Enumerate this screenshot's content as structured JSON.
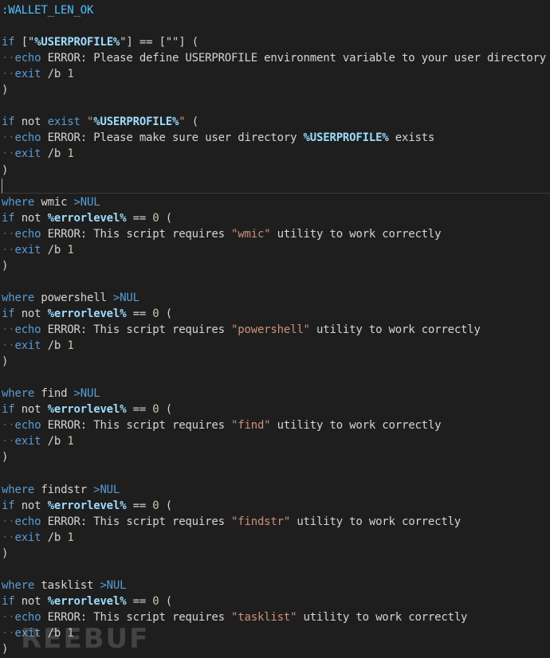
{
  "editor": {
    "lines": [
      [
        {
          "t": ":WALLET_LEN_OK",
          "c": "label"
        }
      ],
      [],
      [
        {
          "t": "if",
          "c": "kw"
        },
        {
          "t": " ",
          "c": "ws"
        },
        {
          "t": "[\"",
          "c": "txt"
        },
        {
          "t": "%USERPROFILE%",
          "c": "var"
        },
        {
          "t": "\"]",
          "c": "txt"
        },
        {
          "t": " ",
          "c": "ws"
        },
        {
          "t": "==",
          "c": "txt"
        },
        {
          "t": " ",
          "c": "ws"
        },
        {
          "t": "[\"\"]",
          "c": "txt"
        },
        {
          "t": " ",
          "c": "ws"
        },
        {
          "t": "(",
          "c": "txt"
        }
      ],
      [
        {
          "t": "··",
          "c": "ws"
        },
        {
          "t": "echo",
          "c": "kw"
        },
        {
          "t": " ERROR: Please define USERPROFILE environment variable to your user directory",
          "c": "txt"
        }
      ],
      [
        {
          "t": "··",
          "c": "ws"
        },
        {
          "t": "exit",
          "c": "kw"
        },
        {
          "t": " /b ",
          "c": "txt"
        },
        {
          "t": "1",
          "c": "num"
        }
      ],
      [
        {
          "t": ")",
          "c": "txt"
        }
      ],
      [],
      [
        {
          "t": "if",
          "c": "kw"
        },
        {
          "t": " not ",
          "c": "txt"
        },
        {
          "t": "exist",
          "c": "kw"
        },
        {
          "t": " ",
          "c": "ws"
        },
        {
          "t": "\"",
          "c": "str"
        },
        {
          "t": "%USERPROFILE%",
          "c": "var"
        },
        {
          "t": "\"",
          "c": "str"
        },
        {
          "t": " (",
          "c": "txt"
        }
      ],
      [
        {
          "t": "··",
          "c": "ws"
        },
        {
          "t": "echo",
          "c": "kw"
        },
        {
          "t": " ERROR: Please make sure user directory ",
          "c": "txt"
        },
        {
          "t": "%USERPROFILE%",
          "c": "var"
        },
        {
          "t": " exists",
          "c": "txt"
        }
      ],
      [
        {
          "t": "··",
          "c": "ws"
        },
        {
          "t": "exit",
          "c": "kw"
        },
        {
          "t": " /b ",
          "c": "txt"
        },
        {
          "t": "1",
          "c": "num"
        }
      ],
      [
        {
          "t": ")",
          "c": "txt"
        }
      ],
      [],
      [
        {
          "t": "where",
          "c": "kw"
        },
        {
          "t": " wmic ",
          "c": "txt"
        },
        {
          "t": ">NUL",
          "c": "kw"
        }
      ],
      [
        {
          "t": "if",
          "c": "kw"
        },
        {
          "t": " not ",
          "c": "txt"
        },
        {
          "t": "%errorlevel%",
          "c": "var"
        },
        {
          "t": " == ",
          "c": "txt"
        },
        {
          "t": "0",
          "c": "num"
        },
        {
          "t": " (",
          "c": "txt"
        }
      ],
      [
        {
          "t": "··",
          "c": "ws"
        },
        {
          "t": "echo",
          "c": "kw"
        },
        {
          "t": " ERROR: This script requires ",
          "c": "txt"
        },
        {
          "t": "\"wmic\"",
          "c": "str"
        },
        {
          "t": " utility to work correctly",
          "c": "txt"
        }
      ],
      [
        {
          "t": "··",
          "c": "ws"
        },
        {
          "t": "exit",
          "c": "kw"
        },
        {
          "t": " /b ",
          "c": "txt"
        },
        {
          "t": "1",
          "c": "num"
        }
      ],
      [
        {
          "t": ")",
          "c": "txt"
        }
      ],
      [],
      [
        {
          "t": "where",
          "c": "kw"
        },
        {
          "t": " powershell ",
          "c": "txt"
        },
        {
          "t": ">NUL",
          "c": "kw"
        }
      ],
      [
        {
          "t": "if",
          "c": "kw"
        },
        {
          "t": " not ",
          "c": "txt"
        },
        {
          "t": "%errorlevel%",
          "c": "var"
        },
        {
          "t": " == ",
          "c": "txt"
        },
        {
          "t": "0",
          "c": "num"
        },
        {
          "t": " (",
          "c": "txt"
        }
      ],
      [
        {
          "t": "··",
          "c": "ws"
        },
        {
          "t": "echo",
          "c": "kw"
        },
        {
          "t": " ERROR: This script requires ",
          "c": "txt"
        },
        {
          "t": "\"powershell\"",
          "c": "str"
        },
        {
          "t": " utility to work correctly",
          "c": "txt"
        }
      ],
      [
        {
          "t": "··",
          "c": "ws"
        },
        {
          "t": "exit",
          "c": "kw"
        },
        {
          "t": " /b ",
          "c": "txt"
        },
        {
          "t": "1",
          "c": "num"
        }
      ],
      [
        {
          "t": ")",
          "c": "txt"
        }
      ],
      [],
      [
        {
          "t": "where",
          "c": "kw"
        },
        {
          "t": " find ",
          "c": "txt"
        },
        {
          "t": ">NUL",
          "c": "kw"
        }
      ],
      [
        {
          "t": "if",
          "c": "kw"
        },
        {
          "t": " not ",
          "c": "txt"
        },
        {
          "t": "%errorlevel%",
          "c": "var"
        },
        {
          "t": " == ",
          "c": "txt"
        },
        {
          "t": "0",
          "c": "num"
        },
        {
          "t": " (",
          "c": "txt"
        }
      ],
      [
        {
          "t": "··",
          "c": "ws"
        },
        {
          "t": "echo",
          "c": "kw"
        },
        {
          "t": " ERROR: This script requires ",
          "c": "txt"
        },
        {
          "t": "\"find\"",
          "c": "str"
        },
        {
          "t": " utility to work correctly",
          "c": "txt"
        }
      ],
      [
        {
          "t": "··",
          "c": "ws"
        },
        {
          "t": "exit",
          "c": "kw"
        },
        {
          "t": " /b ",
          "c": "txt"
        },
        {
          "t": "1",
          "c": "num"
        }
      ],
      [
        {
          "t": ")",
          "c": "txt"
        }
      ],
      [],
      [
        {
          "t": "where",
          "c": "kw"
        },
        {
          "t": " findstr ",
          "c": "txt"
        },
        {
          "t": ">NUL",
          "c": "kw"
        }
      ],
      [
        {
          "t": "if",
          "c": "kw"
        },
        {
          "t": " not ",
          "c": "txt"
        },
        {
          "t": "%errorlevel%",
          "c": "var"
        },
        {
          "t": " == ",
          "c": "txt"
        },
        {
          "t": "0",
          "c": "num"
        },
        {
          "t": " (",
          "c": "txt"
        }
      ],
      [
        {
          "t": "··",
          "c": "ws"
        },
        {
          "t": "echo",
          "c": "kw"
        },
        {
          "t": " ERROR: This script requires ",
          "c": "txt"
        },
        {
          "t": "\"findstr\"",
          "c": "str"
        },
        {
          "t": " utility to work correctly",
          "c": "txt"
        }
      ],
      [
        {
          "t": "··",
          "c": "ws"
        },
        {
          "t": "exit",
          "c": "kw"
        },
        {
          "t": " /b ",
          "c": "txt"
        },
        {
          "t": "1",
          "c": "num"
        }
      ],
      [
        {
          "t": ")",
          "c": "txt"
        }
      ],
      [],
      [
        {
          "t": "where",
          "c": "kw"
        },
        {
          "t": " tasklist ",
          "c": "txt"
        },
        {
          "t": ">NUL",
          "c": "kw"
        }
      ],
      [
        {
          "t": "if",
          "c": "kw"
        },
        {
          "t": " not ",
          "c": "txt"
        },
        {
          "t": "%errorlevel%",
          "c": "var"
        },
        {
          "t": " == ",
          "c": "txt"
        },
        {
          "t": "0",
          "c": "num"
        },
        {
          "t": " (",
          "c": "txt"
        }
      ],
      [
        {
          "t": "··",
          "c": "ws"
        },
        {
          "t": "echo",
          "c": "kw"
        },
        {
          "t": " ERROR: This script requires ",
          "c": "txt"
        },
        {
          "t": "\"tasklist\"",
          "c": "str"
        },
        {
          "t": " utility to work correctly",
          "c": "txt"
        }
      ],
      [
        {
          "t": "··",
          "c": "ws"
        },
        {
          "t": "exit",
          "c": "kw"
        },
        {
          "t": " /b ",
          "c": "txt"
        },
        {
          "t": "1",
          "c": "num"
        }
      ],
      [
        {
          "t": ")",
          "c": "txt"
        }
      ]
    ]
  },
  "watermark": "REEBUF",
  "colors": {
    "background": "#1e1e1e",
    "keyword": "#569cd6",
    "string": "#ce9178",
    "variable": "#9cdcfe",
    "number": "#b5cea8",
    "text": "#d4d4d4",
    "label": "#4fc1ff"
  }
}
